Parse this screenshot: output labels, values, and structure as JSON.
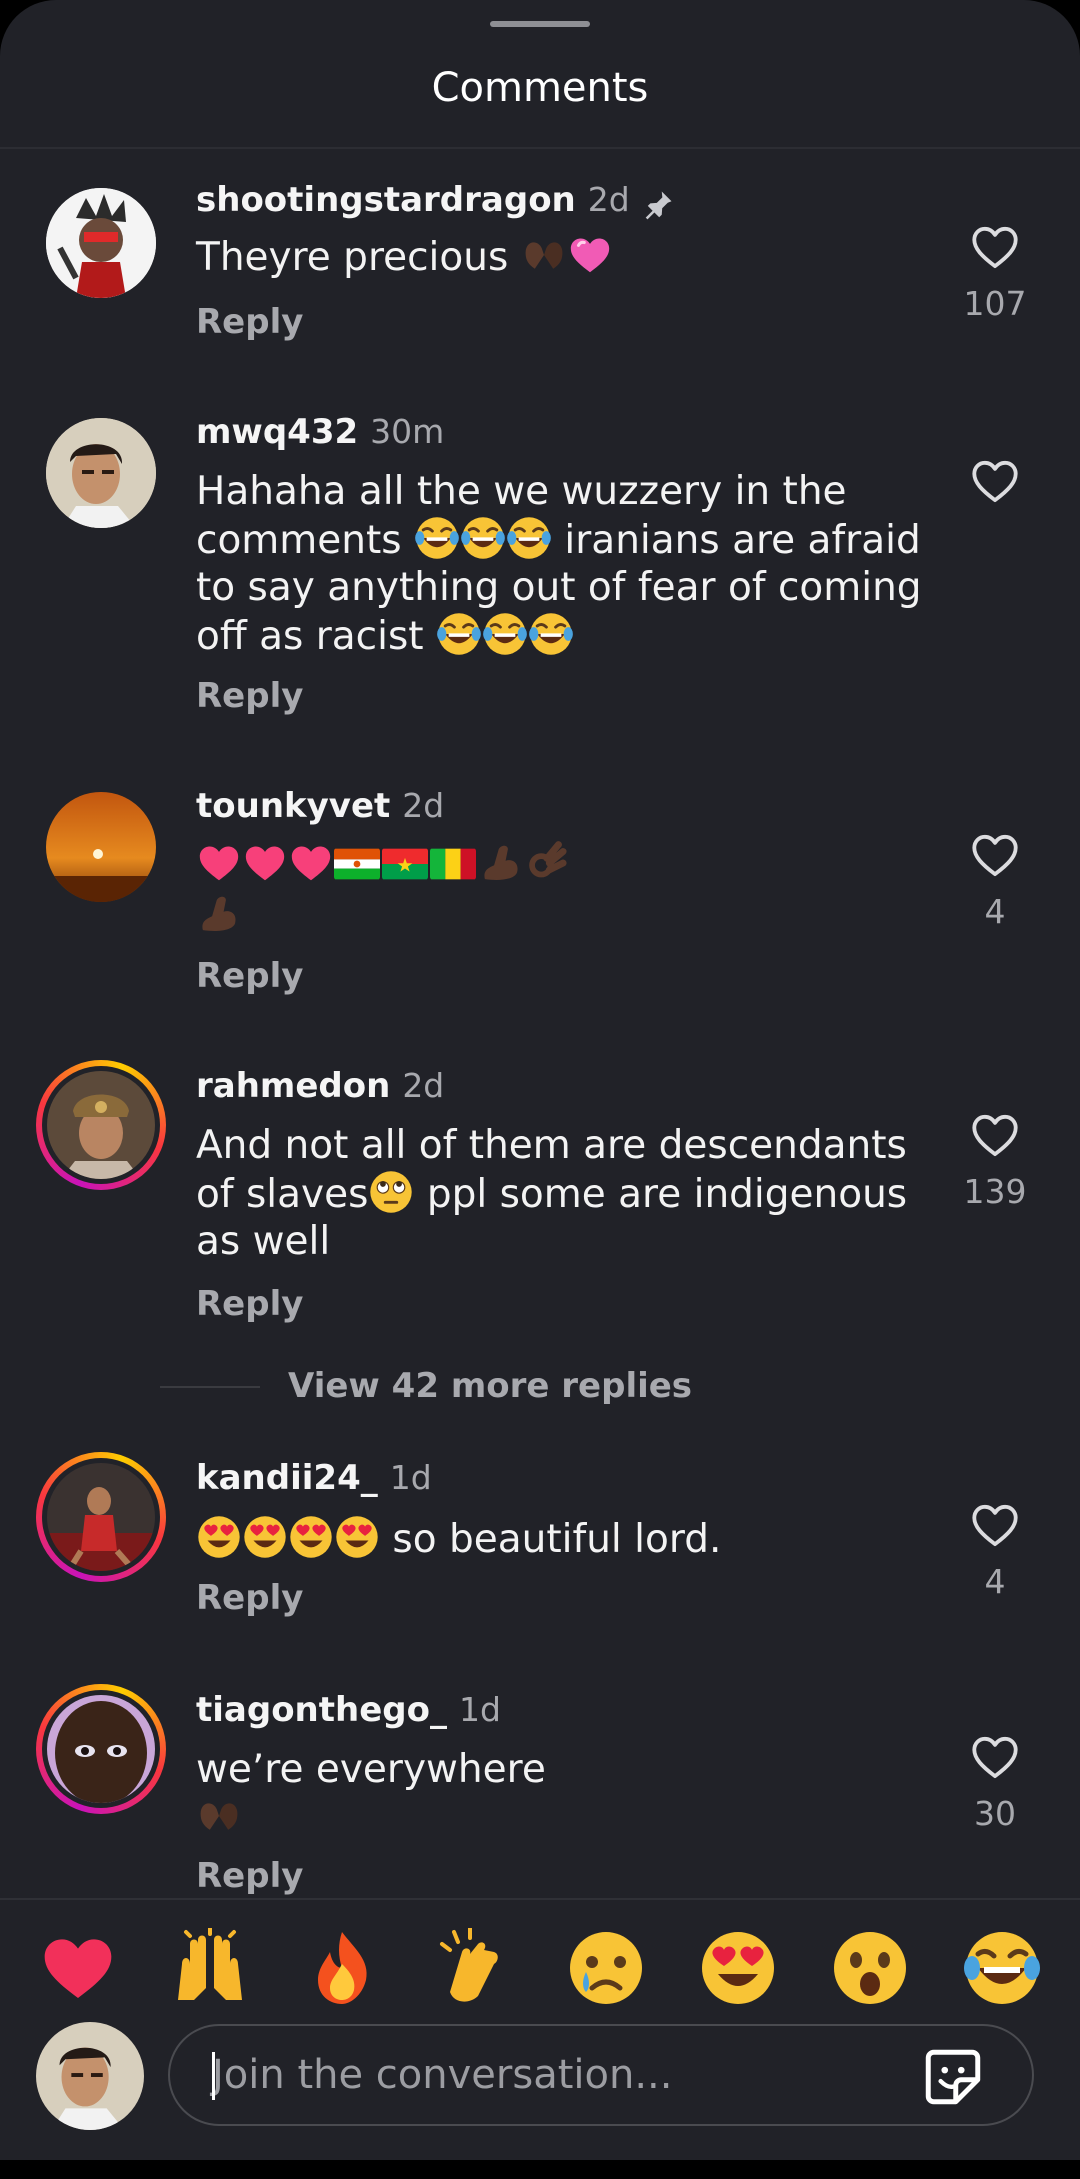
{
  "sheet": {
    "title": "Comments"
  },
  "comments": [
    {
      "username": "shootingstardragon",
      "time": "2d",
      "pinned": true,
      "text": "Theyre precious",
      "reply_label": "Reply",
      "likes": "107"
    },
    {
      "username": "mwq432",
      "time": "30m",
      "text_lines": [
        "Hahaha all the we wuzzery in the",
        "comments",
        "iranians are afraid",
        "to say anything out of fear of coming",
        "off as racist"
      ],
      "reply_label": "Reply",
      "likes": ""
    },
    {
      "username": "tounkyvet",
      "time": "2d",
      "text": "",
      "reply_label": "Reply",
      "likes": "4"
    },
    {
      "username": "rahmedon",
      "time": "2d",
      "text_lines": [
        "And not all of them are descendants",
        "of slaves",
        "ppl some are indigenous",
        "as well"
      ],
      "reply_label": "Reply",
      "likes": "139"
    },
    {
      "username": "kandii24_",
      "time": "1d",
      "text": "so beautiful  lord.",
      "reply_label": "Reply",
      "likes": "4"
    },
    {
      "username": "tiagonthego_",
      "time": "1d",
      "text": "we’re everywhere",
      "reply_label": "Reply",
      "likes": "30"
    }
  ],
  "view_more": {
    "label": "View 42 more replies"
  },
  "reactions": [
    "red-heart",
    "raising-hands",
    "fire",
    "clapping-hands",
    "crying-face",
    "heart-eyes",
    "astonished-face",
    "tears-of-joy"
  ],
  "composer": {
    "placeholder": "Join the conversation..."
  },
  "colors": {
    "background": "#212228",
    "text": "#f3f3f3",
    "muted": "#a8a9ae"
  }
}
